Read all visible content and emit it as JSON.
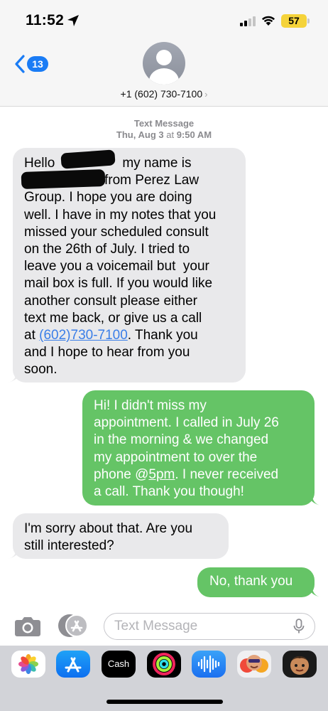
{
  "status_bar": {
    "time": "11:52",
    "battery": "57"
  },
  "header": {
    "back_count": "13",
    "contact": "+1 (602) 730-7100",
    "contact_chevron": "›"
  },
  "timestamp": {
    "label": "Text Message",
    "date": "Thu, Aug 3",
    "at": "at",
    "time": "9:50 AM"
  },
  "messages": [
    {
      "side": "incoming",
      "lines": [
        "Hello",
        "my name is",
        "from Perez Law",
        "Group. I hope you are doing",
        "well. I have in my notes that you",
        "missed your scheduled consult",
        "on the 26th of July. I tried to",
        "leave you a voicemail but  your",
        "mail box is full. If you would like",
        "another consult please either",
        "text me back, or give us a call",
        "at",
        "(602)730-7100",
        ". Thank you",
        "and I hope to hear from you",
        "soon."
      ]
    },
    {
      "side": "outgoing",
      "lines": [
        "Hi! I didn't miss my",
        "appointment. I called in July 26",
        "in the morning & we changed",
        "my appointment to over the",
        "phone @",
        "5pm",
        ". I never received",
        "a call. Thank you though!"
      ]
    },
    {
      "side": "incoming",
      "lines": [
        "I'm sorry about that. Are you",
        "still interested?"
      ]
    },
    {
      "side": "outgoing",
      "lines": [
        "No, thank you"
      ]
    }
  ],
  "compose": {
    "placeholder": "Text Message"
  },
  "drawer": {
    "apps": [
      {
        "name": "photos-icon"
      },
      {
        "name": "app-store-icon"
      },
      {
        "name": "apple-cash-icon",
        "label": "Cash"
      },
      {
        "name": "fitness-icon"
      },
      {
        "name": "audio-message-icon"
      },
      {
        "name": "memoji-stickers-icon"
      },
      {
        "name": "memoji-icon"
      }
    ]
  },
  "colors": {
    "incoming_bubble": "#e9e9eb",
    "outgoing_bubble": "#65c466",
    "link": "#3a7ee8",
    "badge": "#1a7cf5",
    "battery": "#f5d33a"
  }
}
